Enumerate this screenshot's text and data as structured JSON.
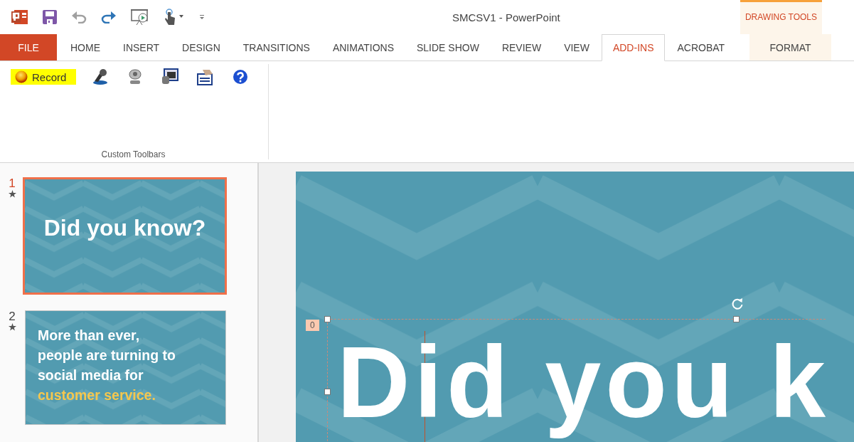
{
  "window": {
    "title": "SMCSV1 - PowerPoint"
  },
  "contextual_group": {
    "label": "DRAWING TOOLS"
  },
  "tabs": [
    {
      "label": "FILE",
      "kind": "file",
      "selected": false
    },
    {
      "label": "HOME",
      "kind": "normal",
      "selected": false
    },
    {
      "label": "INSERT",
      "kind": "normal",
      "selected": false
    },
    {
      "label": "DESIGN",
      "kind": "normal",
      "selected": false
    },
    {
      "label": "TRANSITIONS",
      "kind": "normal",
      "selected": false
    },
    {
      "label": "ANIMATIONS",
      "kind": "normal",
      "selected": false
    },
    {
      "label": "SLIDE SHOW",
      "kind": "normal",
      "selected": false
    },
    {
      "label": "REVIEW",
      "kind": "normal",
      "selected": false
    },
    {
      "label": "VIEW",
      "kind": "normal",
      "selected": false
    },
    {
      "label": "ADD-INS",
      "kind": "normal",
      "selected": true
    },
    {
      "label": "ACROBAT",
      "kind": "normal",
      "selected": false
    },
    {
      "label": "FORMAT",
      "kind": "contextual",
      "selected": false
    }
  ],
  "ribbon": {
    "group_label": "Custom Toolbars",
    "record_button": {
      "label": "Record",
      "highlighted": true
    }
  },
  "slides": [
    {
      "number": "1",
      "selected": true,
      "kind": "title",
      "lines": [
        "Did you know?"
      ]
    },
    {
      "number": "2",
      "selected": false,
      "kind": "body",
      "lines": [
        "More than ever,",
        "people are turning to",
        "social media for"
      ],
      "accent": "customer service."
    }
  ],
  "editor": {
    "title": "Did you k",
    "tag": "0"
  }
}
